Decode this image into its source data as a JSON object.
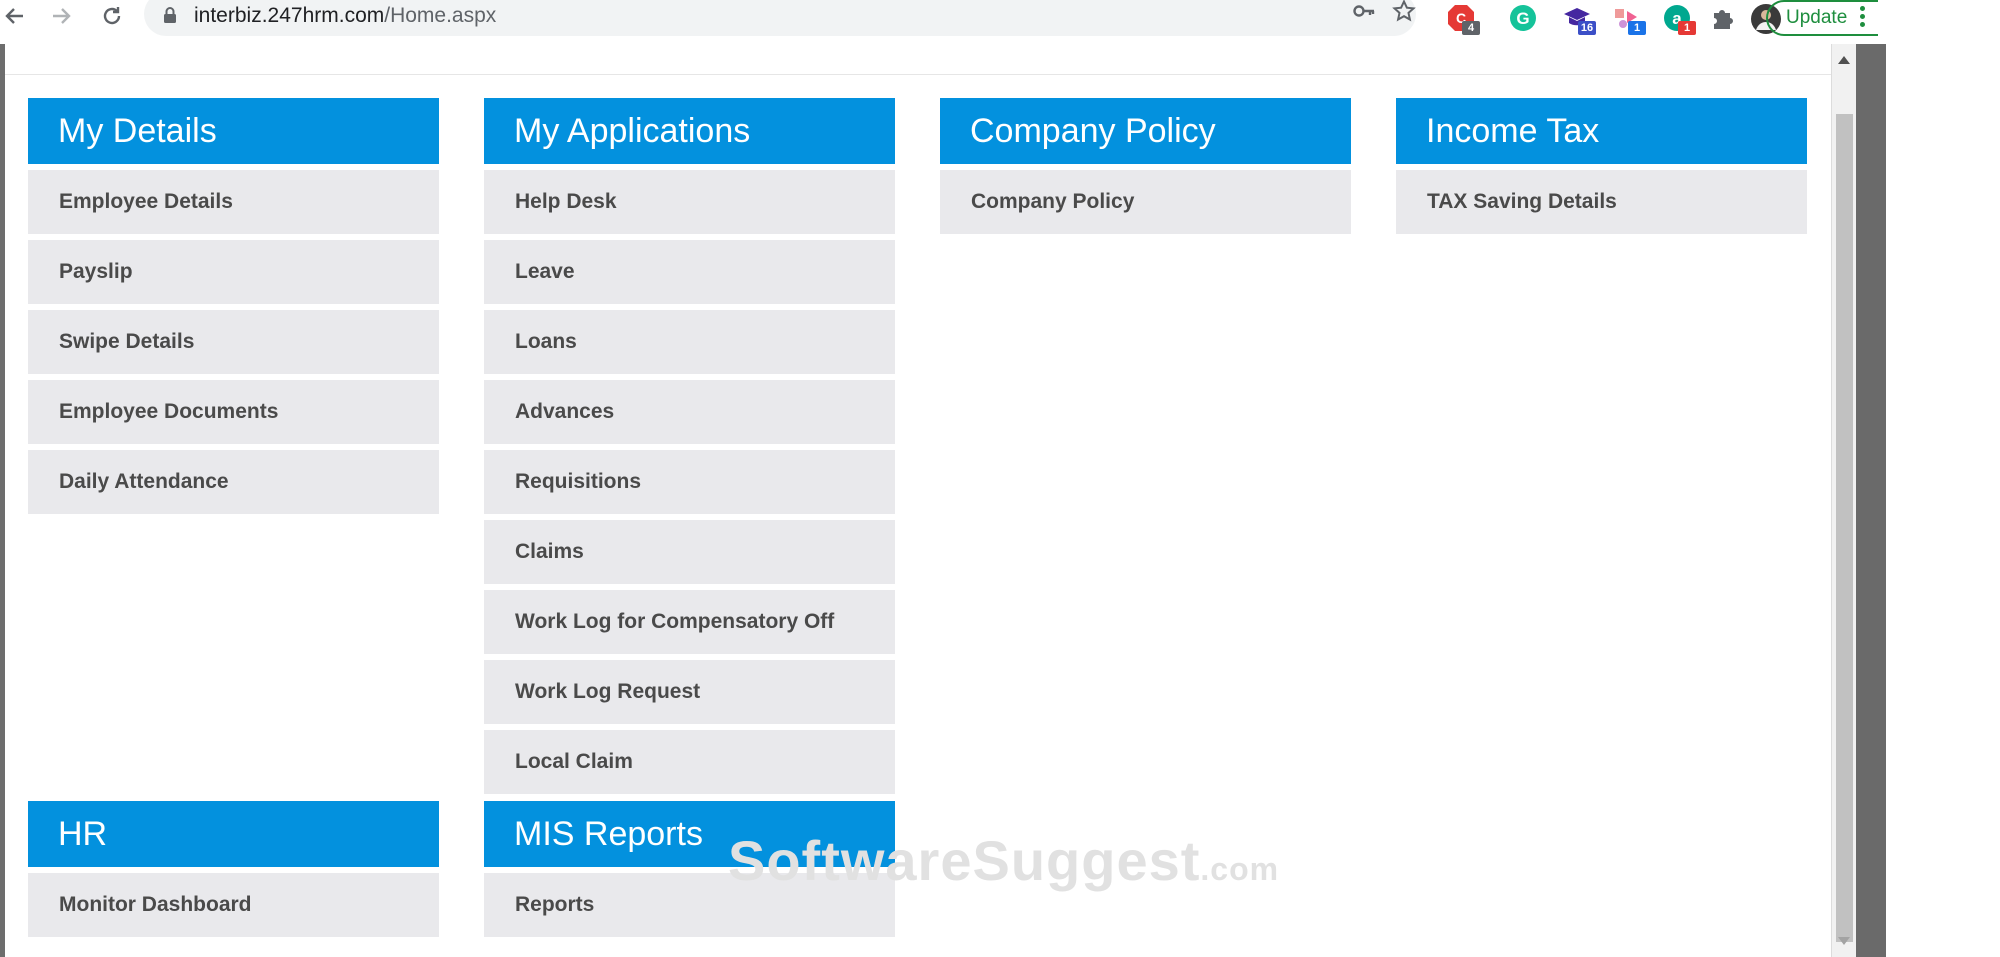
{
  "browser": {
    "url_host": "interbiz.247hrm.com",
    "url_path": "/Home.aspx",
    "update_label": "Update",
    "extensions": [
      {
        "name": "adblock-icon",
        "badge": "4",
        "badge_color": "#5f6368"
      },
      {
        "name": "grammarly-icon",
        "badge": ""
      },
      {
        "name": "graduation-cap-icon",
        "badge": "16",
        "badge_color": "#3c4fc7"
      },
      {
        "name": "shapes-icon",
        "badge": "1",
        "badge_color": "#1a73e8"
      },
      {
        "name": "a-circle-icon",
        "badge": "1",
        "badge_color": "#e53935"
      }
    ]
  },
  "colors": {
    "header_blue": "#0391de",
    "item_bg": "#e9e9ec",
    "item_text": "#4a4a4a"
  },
  "panels": {
    "my_details": {
      "title": "My Details",
      "items": [
        "Employee Details",
        "Payslip",
        "Swipe Details",
        "Employee Documents",
        "Daily Attendance"
      ]
    },
    "my_applications": {
      "title": "My Applications",
      "items": [
        "Help Desk",
        "Leave",
        "Loans",
        "Advances",
        "Requisitions",
        "Claims",
        "Work Log for Compensatory Off",
        "Work Log Request",
        "Local Claim"
      ]
    },
    "company_policy": {
      "title": "Company Policy",
      "items": [
        "Company Policy"
      ]
    },
    "income_tax": {
      "title": "Income Tax",
      "items": [
        "TAX Saving Details"
      ]
    },
    "hr": {
      "title": "HR",
      "items": [
        "Monitor Dashboard"
      ]
    },
    "mis_reports": {
      "title": "MIS Reports",
      "items": [
        "Reports"
      ]
    }
  },
  "watermark": {
    "name": "SoftwareSuggest",
    "tld": ".com"
  }
}
